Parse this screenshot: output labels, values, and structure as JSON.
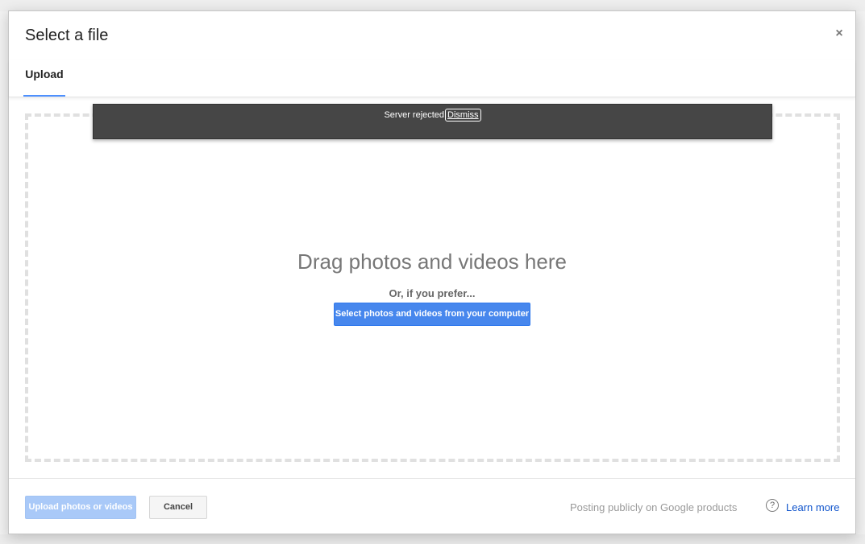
{
  "dialog": {
    "title": "Select a file",
    "close_label": "×"
  },
  "tabs": [
    {
      "label": "Upload",
      "active": true
    }
  ],
  "toast": {
    "message": "Server rejected",
    "dismiss_label": "Dismiss"
  },
  "dropzone": {
    "title": "Drag photos and videos here",
    "subtitle": "Or, if you prefer...",
    "select_button_label": "Select photos and videos from your computer"
  },
  "footer": {
    "upload_button_label": "Upload photos or videos",
    "upload_button_disabled": true,
    "cancel_button_label": "Cancel",
    "posting_text": "Posting publicly on Google products",
    "help_icon_glyph": "?",
    "learn_more_label": "Learn more"
  },
  "colors": {
    "accent": "#4787ed",
    "tab_underline": "#4d90fe",
    "toast_background": "#464646",
    "link": "#1155cc"
  },
  "icons": {
    "close": "close-icon",
    "help": "help-circle-icon"
  }
}
